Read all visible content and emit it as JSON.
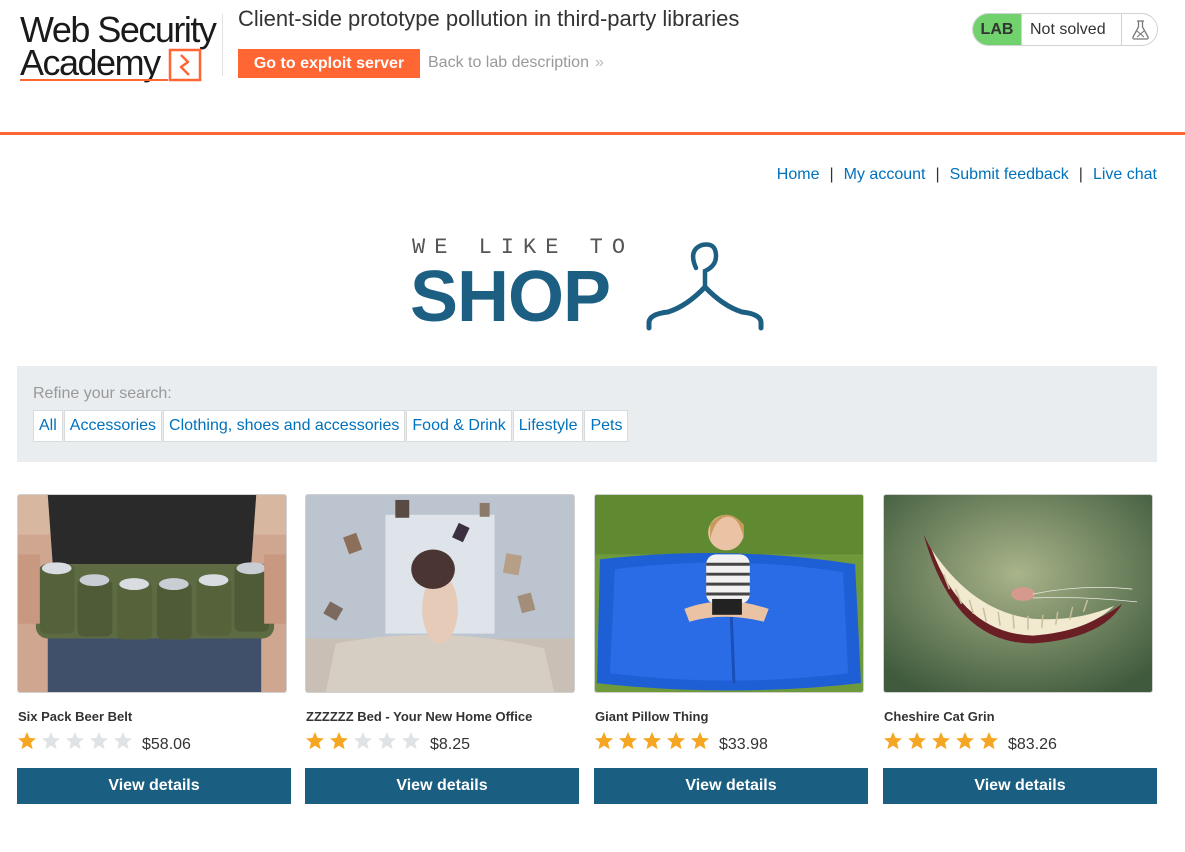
{
  "academy": {
    "logo_line1": "Web Security",
    "logo_line2": "Academy",
    "lab_title": "Client-side prototype pollution in third-party libraries",
    "exploit_button": "Go to exploit server",
    "back_link": "Back to lab description",
    "back_chevron": "»",
    "lab_badge": "LAB",
    "status": "Not solved",
    "status_icon": "flask-icon",
    "accent_color": "#ff6633",
    "badge_color": "#70d16d"
  },
  "nav": {
    "items": [
      "Home",
      "My account",
      "Submit feedback",
      "Live chat"
    ],
    "separator": "|"
  },
  "shop_logo": {
    "tagline": "WE LIKE TO",
    "word": "SHOP",
    "icon": "hanger-icon",
    "color": "#1c5f82"
  },
  "filters": {
    "label": "Refine your search:",
    "items": [
      "All",
      "Accessories",
      "Clothing, shoes and accessories",
      "Food & Drink",
      "Lifestyle",
      "Pets"
    ]
  },
  "products": [
    {
      "name": "Six Pack Beer Belt",
      "rating": 1,
      "max_rating": 5,
      "price": "$58.06",
      "button": "View details",
      "image": "beer-belt-image"
    },
    {
      "name": "ZZZZZZ Bed - Your New Home Office",
      "rating": 2,
      "max_rating": 5,
      "price": "$8.25",
      "button": "View details",
      "image": "bedroom-books-image"
    },
    {
      "name": "Giant Pillow Thing",
      "rating": 5,
      "max_rating": 5,
      "price": "$33.98",
      "button": "View details",
      "image": "giant-pillow-image"
    },
    {
      "name": "Cheshire Cat Grin",
      "rating": 5,
      "max_rating": 5,
      "price": "$83.26",
      "button": "View details",
      "image": "cheshire-grin-image"
    }
  ],
  "colors": {
    "link": "#0071bc",
    "button": "#1a5f81",
    "star_filled": "#f5a623",
    "star_empty": "#dfe3e6",
    "filter_bg": "#e9edef"
  }
}
